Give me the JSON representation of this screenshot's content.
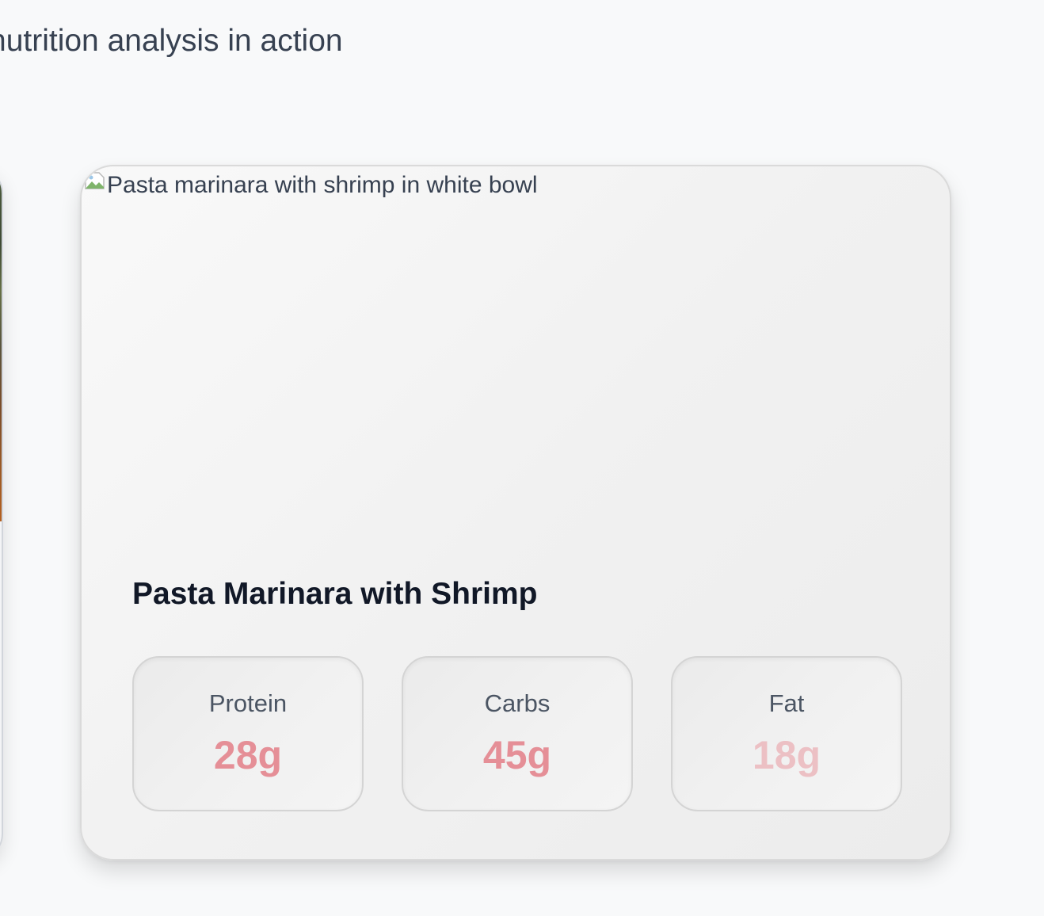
{
  "section": {
    "subtitle": "nutrition analysis in action"
  },
  "card": {
    "image_alt": "Pasta marinara with shrimp in white bowl",
    "image_icon": "broken-image-icon",
    "title": "Pasta Marinara with Shrimp",
    "macros": [
      {
        "label": "Protein",
        "value": "28g",
        "color": "#e58f97"
      },
      {
        "label": "Carbs",
        "value": "45g",
        "color": "#e58f97"
      },
      {
        "label": "Fat",
        "value": "18g",
        "color": "#ecc0c4"
      }
    ]
  }
}
